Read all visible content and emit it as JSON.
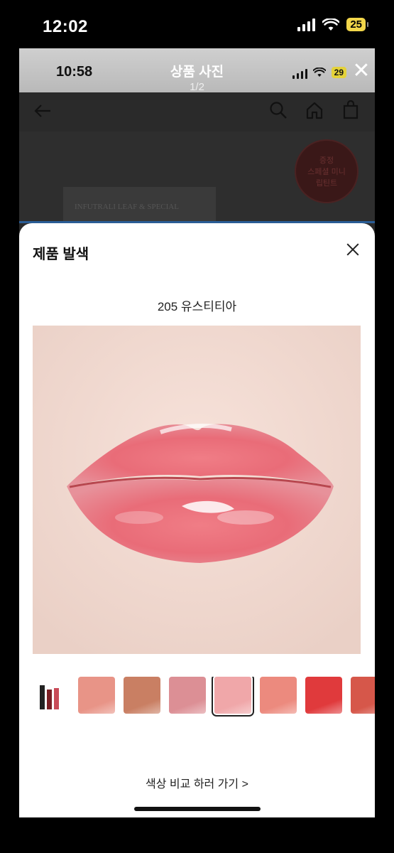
{
  "outer_status": {
    "time": "12:02",
    "battery": "25"
  },
  "inner_status": {
    "time": "10:58",
    "battery": "29"
  },
  "viewer": {
    "title": "상품 사진",
    "counter": "1/2"
  },
  "page_bg": {
    "promo_badge": "증정\n스페셜 미니\n립틴트",
    "promo_box_text": "INFUTRALI LEAF & SPECIAL"
  },
  "sheet": {
    "title": "제품 발색",
    "shade_name": "205 유스티티아",
    "compare_link": "색상 비교 하러 가기 >"
  },
  "swatches": [
    {
      "color": "#e89487",
      "selected": false
    },
    {
      "color": "#c97f63",
      "selected": false
    },
    {
      "color": "#dc8f95",
      "selected": false
    },
    {
      "color": "#f0a7a9",
      "selected": true
    },
    {
      "color": "#ec8a7e",
      "selected": false
    },
    {
      "color": "#e03a3c",
      "selected": false
    },
    {
      "color": "#d6574a",
      "selected": false
    }
  ]
}
